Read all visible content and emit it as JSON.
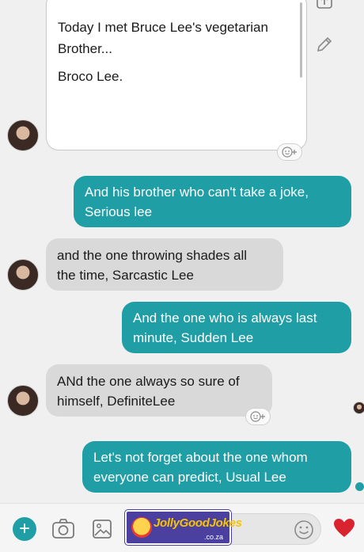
{
  "chat": {
    "card": {
      "line1": "Today I met Bruce Lee's vegetarian",
      "line2": "Brother...",
      "line3": "Broco Lee."
    },
    "messages": [
      {
        "sender": "me",
        "line1": "And his brother who can't take a joke,",
        "line2": "Serious lee"
      },
      {
        "sender": "them",
        "line1": "and the one throwing shades all",
        "line2": "the time, Sarcastic Lee"
      },
      {
        "sender": "me",
        "line1": "And the one who is always last",
        "line2": "minute, Sudden Lee"
      },
      {
        "sender": "them",
        "line1": "ANd the one always so sure of",
        "line2": "himself, DefiniteLee"
      },
      {
        "sender": "me",
        "line1": "Let's not forget about the one whom",
        "line2": "everyone can predict, Usual Lee"
      }
    ]
  },
  "watermark": {
    "name": "JollyGoodJokes",
    "domain": ".co.za"
  },
  "icons": {
    "share": "share-icon",
    "edit": "pencil-icon",
    "reaction": "emoji-plus-icon",
    "add": "plus-icon",
    "camera": "camera-icon",
    "gallery": "image-icon",
    "emoji": "smiley-icon",
    "like": "heart-icon"
  },
  "colors": {
    "outgoing": "#1f9ea6",
    "incoming": "#d9d9d9",
    "heart": "#d9232e"
  }
}
